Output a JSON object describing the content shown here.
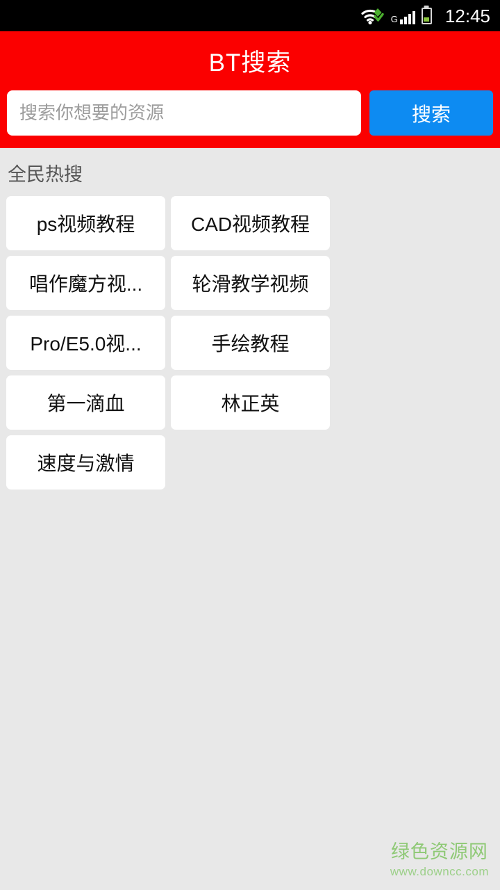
{
  "status_bar": {
    "time": "12:45",
    "network_label": "G",
    "icons": [
      "wifi-icon",
      "signal-icon",
      "battery-icon"
    ],
    "signal_bars": 4,
    "battery_level_pct": 38,
    "colors": {
      "background": "#000000",
      "accent_green": "#8cc63f",
      "text": "#ffffff"
    }
  },
  "header": {
    "title": "BT搜索",
    "background_color": "#fb0000",
    "title_color": "#ffffff"
  },
  "search": {
    "placeholder": "搜索你想要的资源",
    "value": "",
    "button_label": "搜索",
    "button_color": "#0d8bf2"
  },
  "hot": {
    "section_title": "全民热搜",
    "tags": [
      {
        "label": "ps视频教程"
      },
      {
        "label": "CAD视频教程"
      },
      {
        "label": "唱作魔方视..."
      },
      {
        "label": "轮滑教学视频"
      },
      {
        "label": "Pro/E5.0视..."
      },
      {
        "label": "手绘教程"
      },
      {
        "label": "第一滴血"
      },
      {
        "label": "林正英"
      },
      {
        "label": "速度与激情"
      }
    ]
  },
  "watermark": {
    "title": "绿色资源网",
    "url": "www.downcc.com",
    "color": "#8fc976"
  },
  "page": {
    "background_color": "#e8e8e8"
  }
}
